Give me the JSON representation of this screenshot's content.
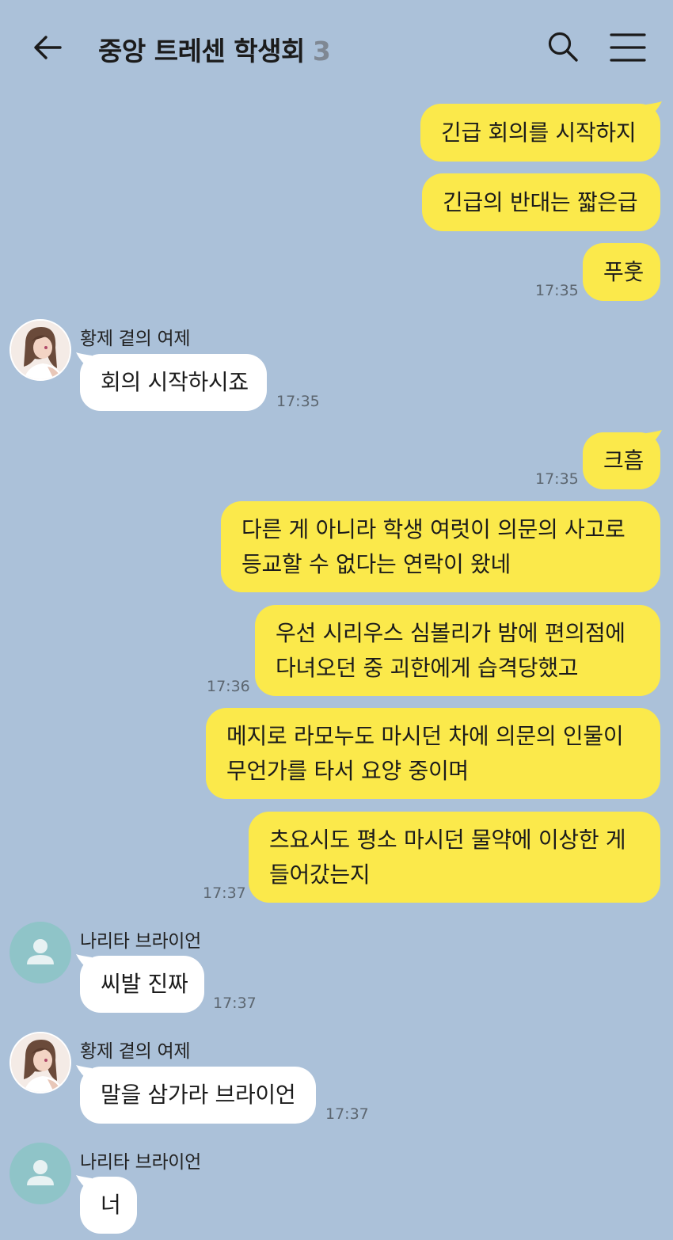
{
  "header": {
    "title": "중앙 트레센 학생회",
    "member_count": "3"
  },
  "colors": {
    "background": "#abc1d9",
    "my_bubble": "#fbe94b",
    "their_bubble": "#ffffff",
    "default_avatar": "#8fc4c8"
  },
  "icons": {
    "back": "back-arrow-icon",
    "search": "search-icon",
    "menu": "hamburger-menu-icon"
  },
  "messages": [
    {
      "sender": "me",
      "text": "긴급 회의를 시작하지"
    },
    {
      "sender": "me",
      "text": "긴급의 반대는 짧은급"
    },
    {
      "sender": "me",
      "text": "푸훗",
      "time": "17:35"
    },
    {
      "sender": "황제 곁의 여제",
      "text": "회의 시작하시죠",
      "time": "17:35"
    },
    {
      "sender": "me",
      "text": "크흠",
      "time": "17:35"
    },
    {
      "sender": "me",
      "text": "다른 게 아니라 학생 여럿이 의문의 사고로 등교할 수 없다는 연락이 왔네"
    },
    {
      "sender": "me",
      "text": "우선 시리우스 심볼리가 밤에 편의점에 다녀오던 중 괴한에게 습격당했고",
      "time": "17:36"
    },
    {
      "sender": "me",
      "text": "메지로 라모누도 마시던 차에 의문의 인물이 무언가를 타서 요양 중이며"
    },
    {
      "sender": "me",
      "text": "츠요시도 평소 마시던 물약에 이상한 게 들어갔는지",
      "time": "17:37"
    },
    {
      "sender": "나리타 브라이언",
      "text": "씨발 진짜",
      "time": "17:37"
    },
    {
      "sender": "황제 곁의 여제",
      "text": "말을 삼가라 브라이언",
      "time": "17:37"
    },
    {
      "sender": "나리타 브라이언",
      "text": "너"
    }
  ]
}
